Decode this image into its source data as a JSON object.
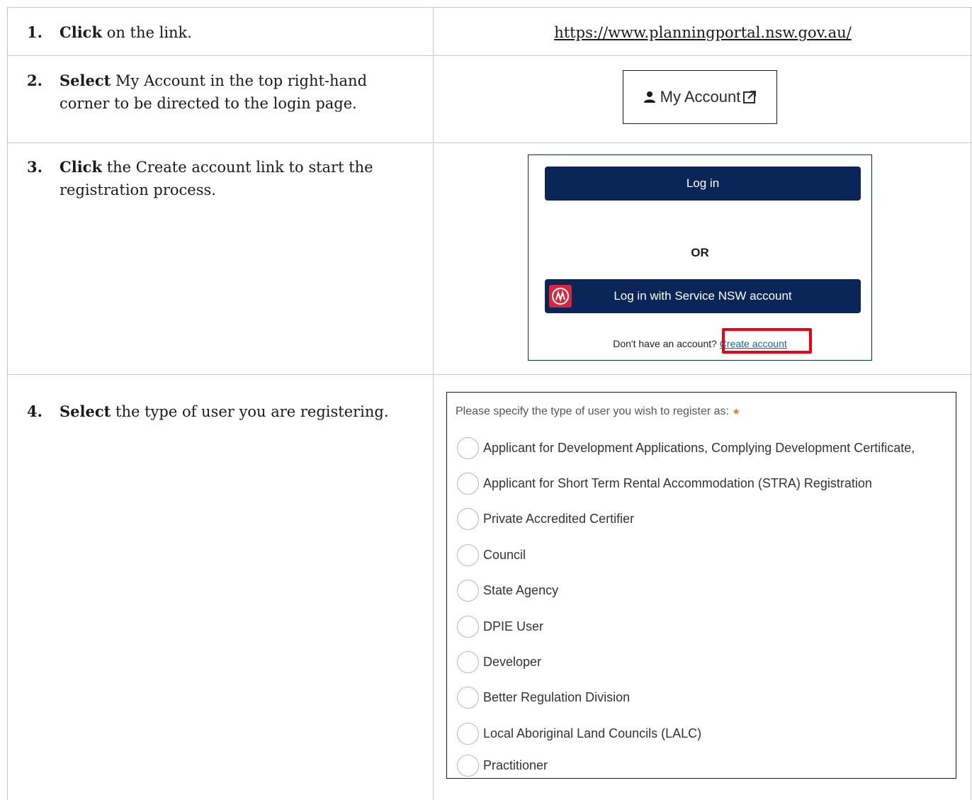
{
  "steps": [
    {
      "number": "1.",
      "action": "Click",
      "text": " on the link."
    },
    {
      "number": "2.",
      "action": "Select",
      "text": " My Account in the top right-hand corner to be directed to the login page."
    },
    {
      "number": "3.",
      "action": "Click",
      "text": " the Create account link to start the registration process."
    },
    {
      "number": "4.",
      "action": "Select",
      "text": " the type of user you are registering."
    }
  ],
  "link_url": "https://www.planningportal.nsw.gov.au/",
  "my_account": {
    "label": "My Account",
    "icon": "user-icon",
    "external_icon": "external-link-icon"
  },
  "login_panel": {
    "login_label": "Log in",
    "or_label": "OR",
    "service_nsw_label": "Log in with Service NSW account",
    "no_account_text": "Don't have an account?",
    "create_account_label": "Create account",
    "highlight_color": "#e30613",
    "button_color": "#0a2659"
  },
  "user_type_form": {
    "prompt": "Please specify the type of user you wish to register as:",
    "required_marker": "★",
    "options": [
      "Applicant for Development Applications, Complying Development Certificate,",
      "Applicant for Short Term Rental Accommodation (STRA) Registration",
      "Private Accredited Certifier",
      "Council",
      "State Agency",
      "DPIE User",
      "Developer",
      "Better Regulation Division",
      "Local Aboriginal Land Councils (LALC)",
      "Practitioner"
    ]
  }
}
